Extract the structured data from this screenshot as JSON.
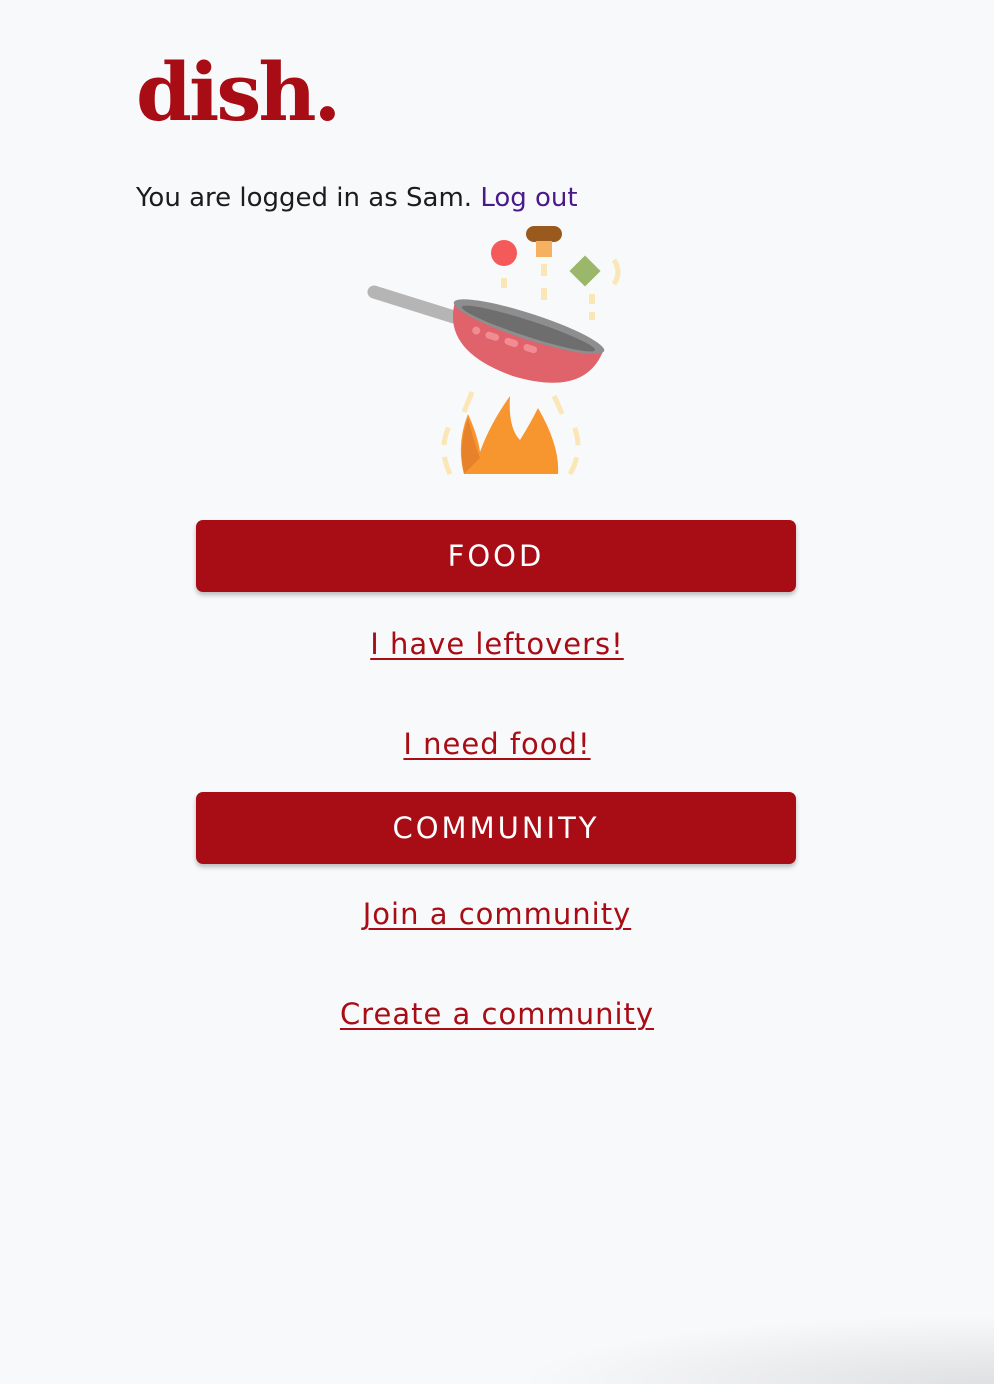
{
  "header": {
    "logo_text": "dish."
  },
  "session": {
    "logged_in_text": "You are logged in as Sam.",
    "logout_label": "Log out"
  },
  "food_section": {
    "button_label": "FOOD",
    "links": [
      "I have leftovers!",
      "I need food!"
    ]
  },
  "community_section": {
    "button_label": "COMMUNITY",
    "links": [
      "Join a community",
      "Create a community"
    ]
  },
  "illustration": {
    "icon": "frying-pan-icon"
  },
  "colors": {
    "brand": "#a80d15",
    "background": "#f8f9fb",
    "text": "#1c1c1c",
    "logout_link": "#4a1a8a",
    "pan_body": "#e0626a",
    "flame": "#f7962f"
  }
}
